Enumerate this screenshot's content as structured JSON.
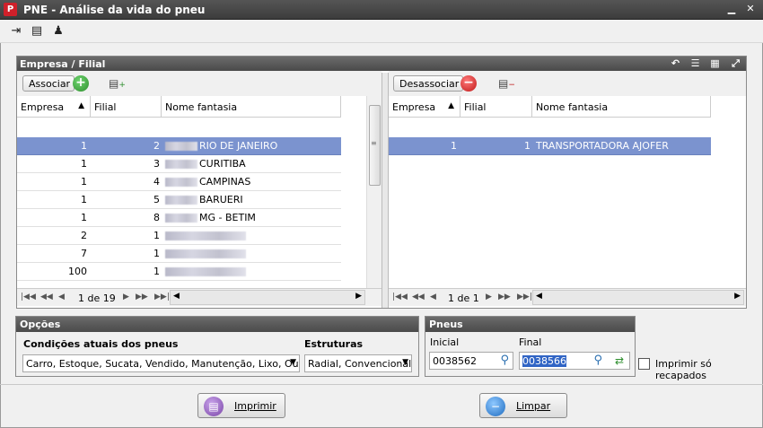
{
  "window": {
    "title": "PNE - Análise da vida do pneu"
  },
  "panel": {
    "title": "Empresa / Filial"
  },
  "left": {
    "button_label": "Associar",
    "columns": [
      "Empresa",
      "Filial",
      "Nome fantasia"
    ],
    "rows": [
      {
        "empresa": "1",
        "filial": "2",
        "nome": "RIO DE JANEIRO",
        "selected": true
      },
      {
        "empresa": "1",
        "filial": "3",
        "nome": "CURITIBA"
      },
      {
        "empresa": "1",
        "filial": "4",
        "nome": "CAMPINAS"
      },
      {
        "empresa": "1",
        "filial": "5",
        "nome": "BARUERI"
      },
      {
        "empresa": "1",
        "filial": "8",
        "nome": "MG - BETIM"
      },
      {
        "empresa": "2",
        "filial": "1",
        "nome": ""
      },
      {
        "empresa": "7",
        "filial": "1",
        "nome": ""
      },
      {
        "empresa": "100",
        "filial": "1",
        "nome": ""
      }
    ],
    "pager": "1 de 19"
  },
  "right": {
    "button_label": "Desassociar",
    "columns": [
      "Empresa",
      "Filial",
      "Nome fantasia"
    ],
    "rows": [
      {
        "empresa": "1",
        "filial": "1",
        "nome": "TRANSPORTADORA AJOFER",
        "selected": true
      }
    ],
    "pager": "1 de 1"
  },
  "opcoes": {
    "title": "Opções",
    "condicoes_label": "Condições atuais dos pneus",
    "condicoes_value": "Carro, Estoque, Sucata, Vendido, Manutenção, Lixo, Out...",
    "estruturas_label": "Estruturas",
    "estruturas_value": "Radial, Convencional"
  },
  "pneus": {
    "title": "Pneus",
    "inicial_label": "Inicial",
    "inicial_value": "0038562",
    "final_label": "Final",
    "final_value": "0038566"
  },
  "recapados": {
    "label": "Imprimir só recapados"
  },
  "buttons": {
    "imprimir": "Imprimir",
    "limpar": "Limpar"
  },
  "colors": {
    "header": "#4a4a4a",
    "selection": "#7b93cf",
    "add": "#3aa63a",
    "remove": "#e03030",
    "print": "#8c5ab8",
    "clear": "#2f7fd0"
  }
}
